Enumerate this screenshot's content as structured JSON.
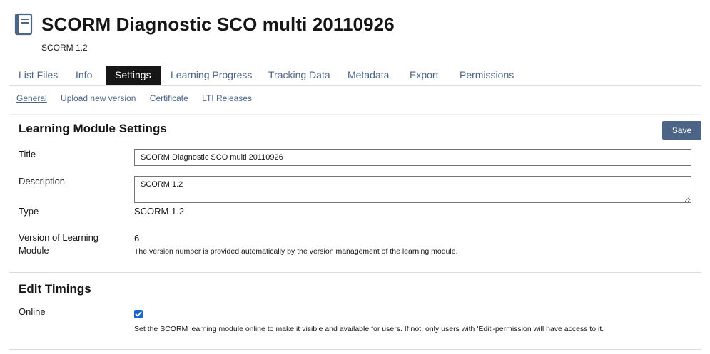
{
  "header": {
    "icon": "book-icon",
    "title": "SCORM Diagnostic SCO multi 20110926",
    "subtitle": "SCORM 1.2"
  },
  "tabs": [
    {
      "label": "List Files"
    },
    {
      "label": "Info"
    },
    {
      "label": "Settings",
      "active": true
    },
    {
      "label": "Learning Progress"
    },
    {
      "label": "Tracking Data"
    },
    {
      "label": "Metadata"
    },
    {
      "label": "Export"
    },
    {
      "label": "Permissions"
    }
  ],
  "subtabs": [
    {
      "label": "General",
      "active": true
    },
    {
      "label": "Upload new version"
    },
    {
      "label": "Certificate"
    },
    {
      "label": "LTI Releases"
    }
  ],
  "settings": {
    "heading": "Learning Module Settings",
    "save_label": "Save",
    "title_label": "Title",
    "title_value": "SCORM Diagnostic SCO multi 20110926",
    "description_label": "Description",
    "description_value": "SCORM 1.2",
    "type_label": "Type",
    "type_value": "SCORM 1.2",
    "version_label": "Version of Learning Module",
    "version_value": "6",
    "version_help": "The version number is provided automatically by the version management of the learning module."
  },
  "timings": {
    "heading": "Edit Timings",
    "online_label": "Online",
    "online_checked": true,
    "online_help": "Set the SCORM learning module online to make it visible and available for users. If not, only users with 'Edit'-permission will have access to it."
  },
  "colors": {
    "accent": "#4c6586",
    "active_tab_bg": "#161616",
    "checkbox": "#1766d4"
  }
}
